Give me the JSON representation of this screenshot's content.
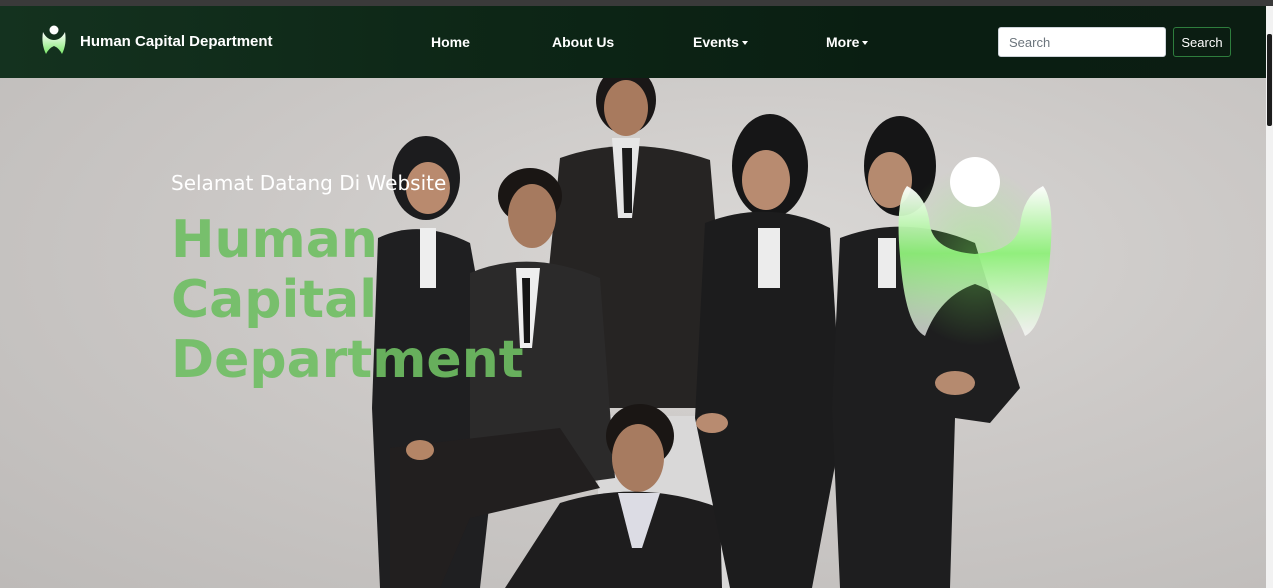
{
  "navbar": {
    "brand": "Human Capital Department",
    "links": [
      {
        "label": "Home",
        "dropdown": false
      },
      {
        "label": "About Us",
        "dropdown": false
      },
      {
        "label": "Events",
        "dropdown": true
      },
      {
        "label": "More",
        "dropdown": true
      }
    ],
    "search_placeholder": "Search",
    "search_button": "Search"
  },
  "hero": {
    "subtitle": "Selamat Datang Di Website",
    "title": "Human Capital Department"
  },
  "colors": {
    "navbar_bg": "#0d2616",
    "accent_green": "#6fbf63",
    "button_border": "#2e7d3d"
  },
  "icons": {
    "brand_logo": "hcd-logo-icon",
    "hero_logo": "hcd-large-logo-icon",
    "dropdown": "caret-down-icon"
  }
}
